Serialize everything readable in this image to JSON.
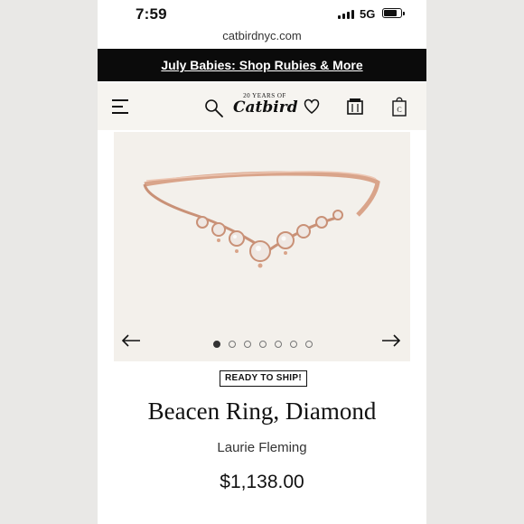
{
  "status_bar": {
    "time": "7:59",
    "network": "5G",
    "battery_level": 0.8
  },
  "browser": {
    "url": "catbirdnyc.com"
  },
  "promo_banner": {
    "text": "July Babies: Shop Rubies & More"
  },
  "header": {
    "logo_tagline": "20 YEARS OF",
    "logo_word": "Catbird",
    "icons": [
      "menu-icon",
      "search-icon",
      "heart-icon",
      "bag-icon",
      "tote-bag-icon"
    ]
  },
  "gallery": {
    "image_count": 7,
    "active_index": 0
  },
  "product": {
    "badge": "READY TO SHIP!",
    "title": "Beacen Ring, Diamond",
    "designer": "Laurie Fleming",
    "price": "$1,138.00"
  },
  "colors": {
    "banner_bg": "#0b0b0b",
    "header_bg": "#f6f4f0",
    "gallery_bg": "#f3f0eb",
    "ring_gold": "#d9a48a"
  }
}
